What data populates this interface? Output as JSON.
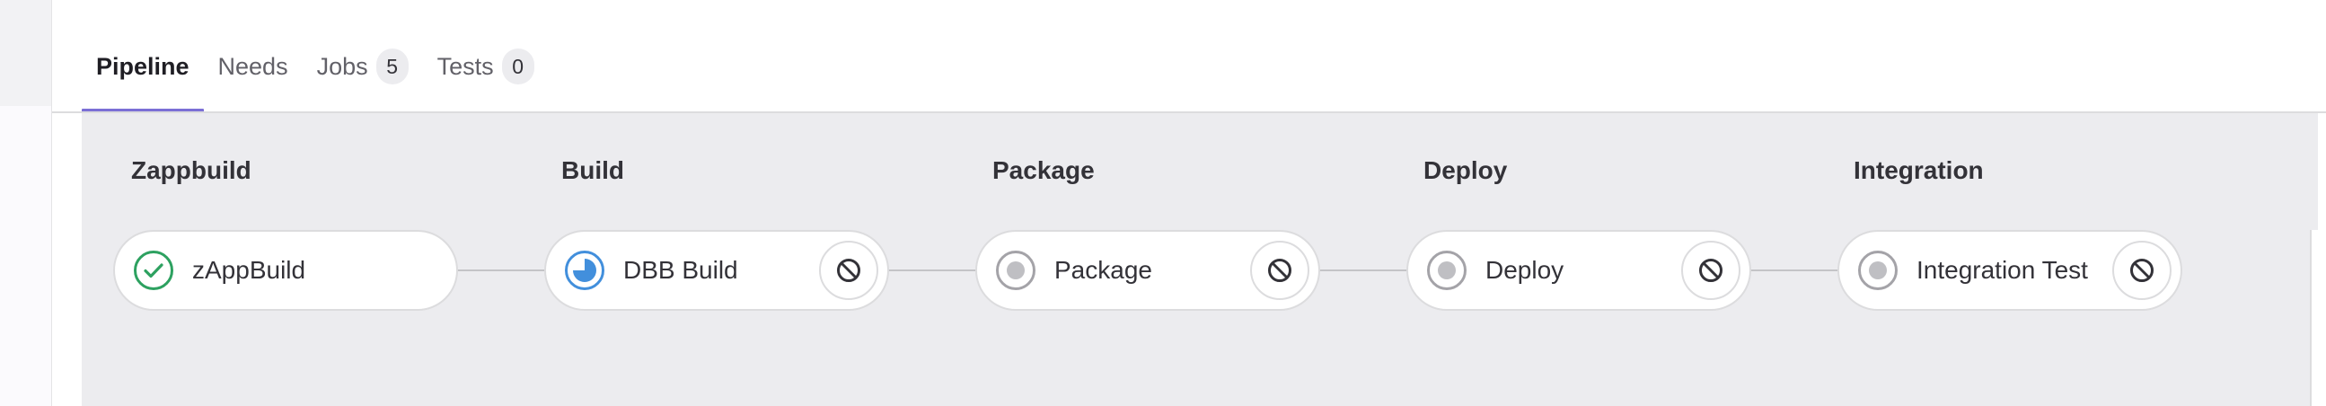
{
  "tabs": [
    {
      "label": "Pipeline",
      "active": true
    },
    {
      "label": "Needs"
    },
    {
      "label": "Jobs",
      "count": "5"
    },
    {
      "label": "Tests",
      "count": "0"
    }
  ],
  "stages": [
    {
      "title": "Zappbuild",
      "job": {
        "name": "zAppBuild",
        "status": "passed",
        "status_icon": "check-circle-icon",
        "cancelable": false
      }
    },
    {
      "title": "Build",
      "job": {
        "name": "DBB Build",
        "status": "running",
        "status_icon": "running-icon",
        "cancelable": true
      }
    },
    {
      "title": "Package",
      "job": {
        "name": "Package",
        "status": "created",
        "status_icon": "created-icon",
        "cancelable": true
      }
    },
    {
      "title": "Deploy",
      "job": {
        "name": "Deploy",
        "status": "created",
        "status_icon": "created-icon",
        "cancelable": true
      }
    },
    {
      "title": "Integration",
      "job": {
        "name": "Integration Test",
        "status": "created",
        "status_icon": "created-icon",
        "cancelable": true
      }
    }
  ],
  "colors": {
    "accent": "#7b6fd6",
    "success": "#2da160",
    "running": "#428fdc",
    "neutral": "#a4a3a8",
    "graph_background": "#ececef"
  }
}
